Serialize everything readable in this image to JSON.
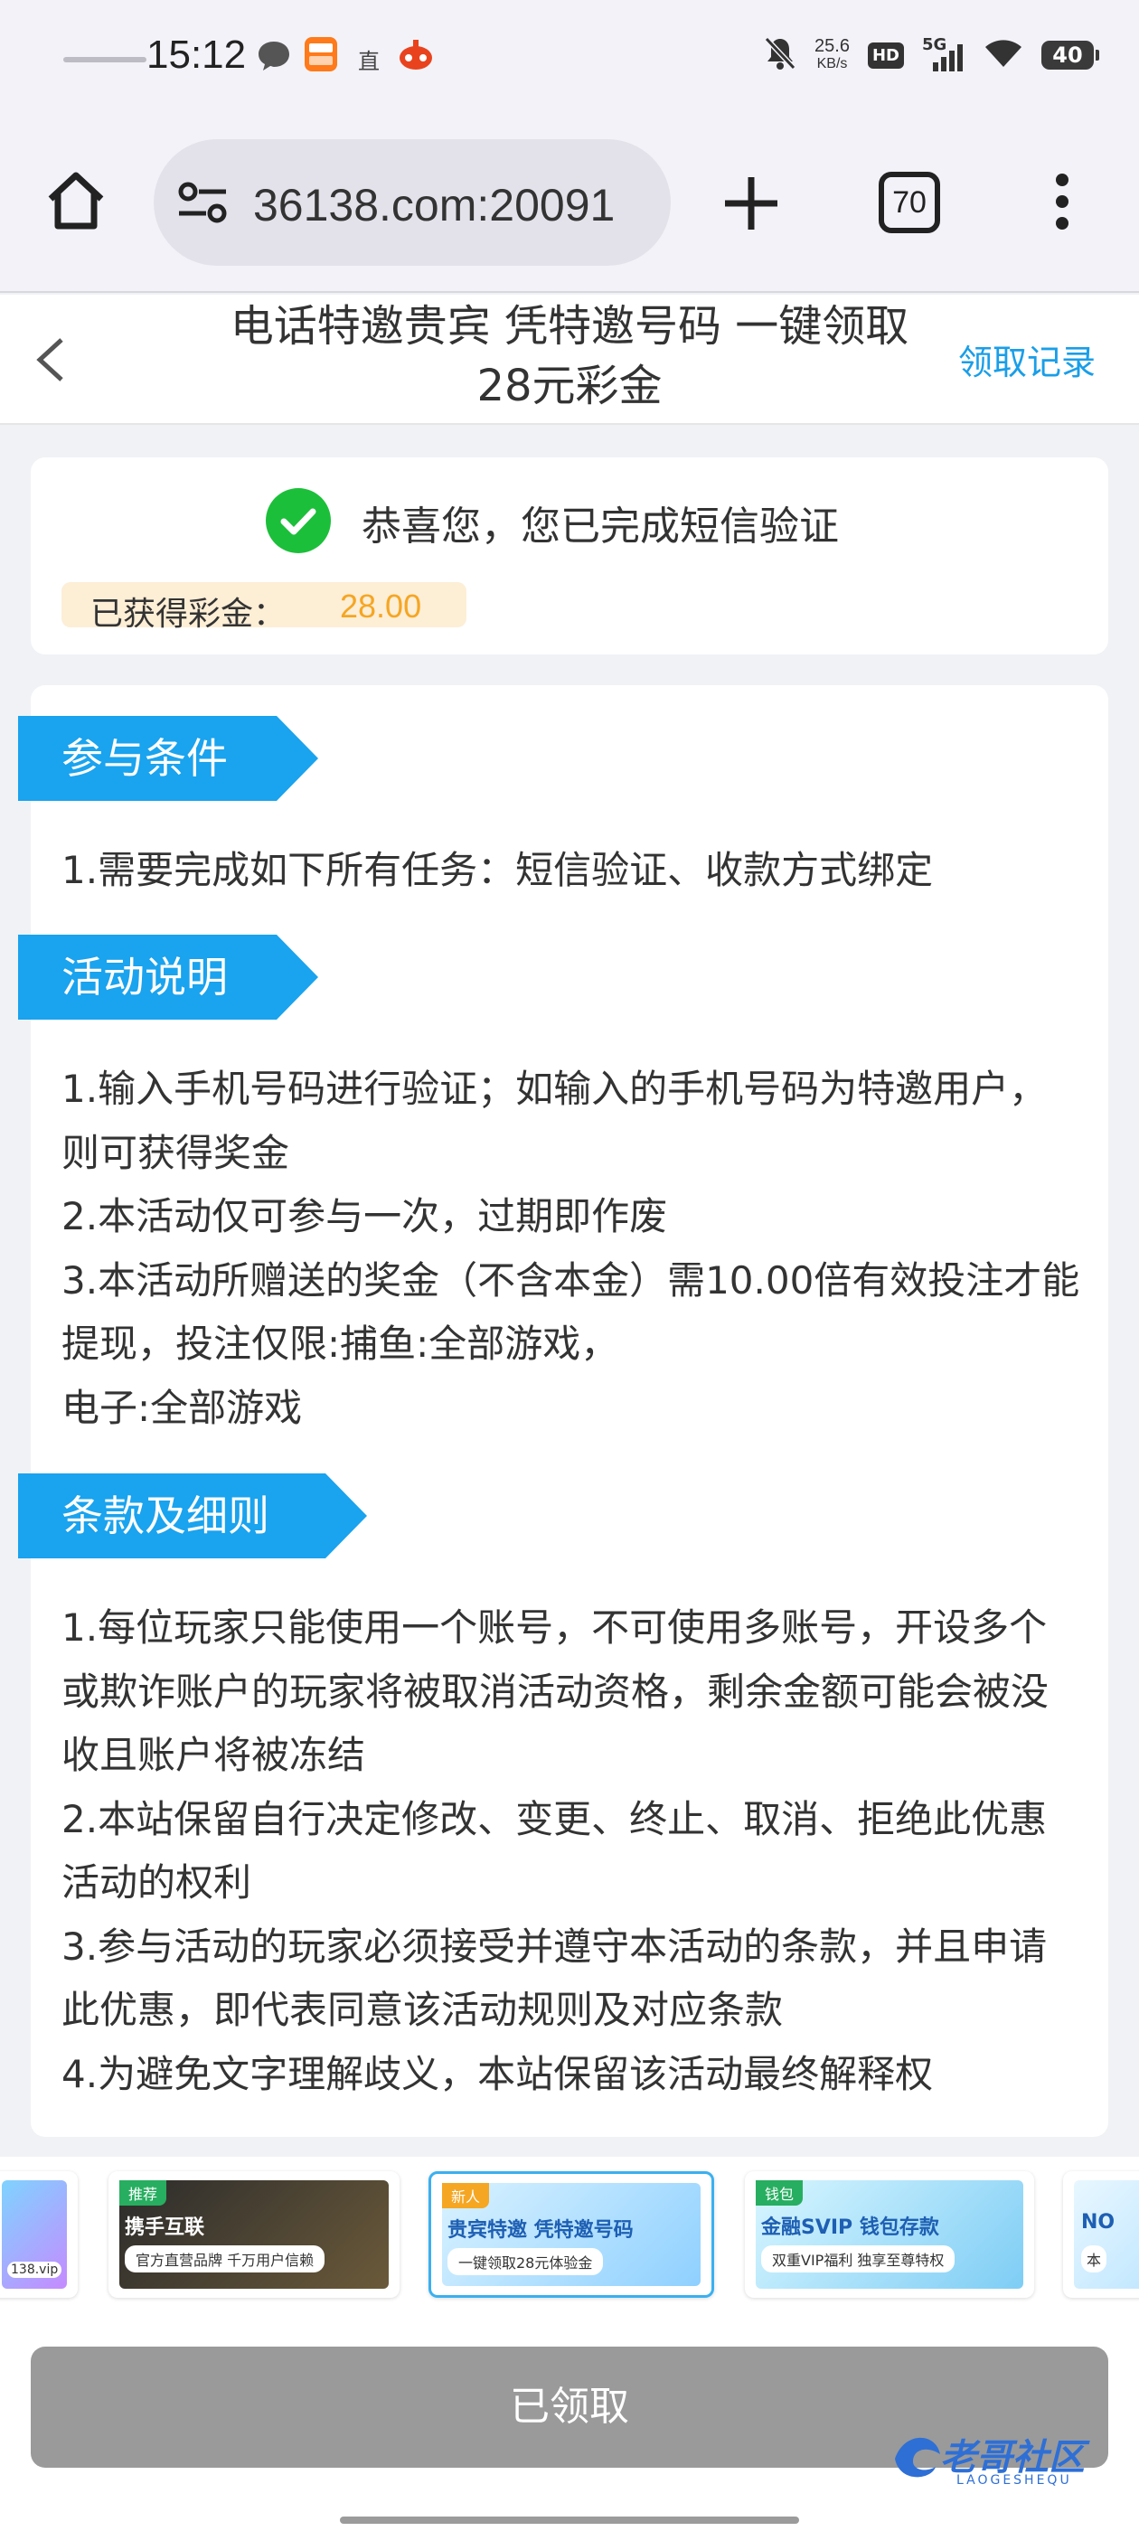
{
  "status_bar": {
    "time": "15:12",
    "net_speed_value": "25.6",
    "net_speed_unit": "KB/s",
    "hd_badge": "HD",
    "network": "5G",
    "battery": "40",
    "live_label": "直",
    "icons": [
      "chat-bubble-icon",
      "taobao-app-icon",
      "live-icon",
      "game-controller-icon",
      "mute-bell-icon",
      "signal-icon",
      "wifi-icon",
      "battery-icon"
    ]
  },
  "browser": {
    "url": "36138.com:20091",
    "tab_count": "70"
  },
  "header": {
    "title": "电话特邀贵宾 凭特邀号码 一键领取28元彩金",
    "records_link": "领取记录"
  },
  "success": {
    "message": "恭喜您，您已完成短信验证",
    "bonus_label": "已获得彩金：",
    "bonus_value": "28.00"
  },
  "sections": [
    {
      "title": "参与条件",
      "lines": [
        "1.需要完成如下所有任务：短信验证、收款方式绑定"
      ]
    },
    {
      "title": "活动说明",
      "lines": [
        "1.输入手机号码进行验证；如输入的手机号码为特邀用户，则可获得奖金",
        "2.本活动仅可参与一次，过期即作废",
        "3.本活动所赠送的奖金（不含本金）需10.00倍有效投注才能提现，投注仅限:捕鱼:全部游戏，",
        "电子:全部游戏"
      ]
    },
    {
      "title": "条款及细则",
      "lines": [
        "1.每位玩家只能使用一个账号，不可使用多账号，开设多个或欺诈账户的玩家将被取消活动资格，剩余金额可能会被没收且账户将被冻结",
        "2.本站保留自行决定修改、变更、终止、取消、拒绝此优惠活动的权利",
        "3.参与活动的玩家必须接受并遵守本活动的条款，并且申请此优惠，即代表同意该活动规则及对应条款",
        "4.为避免文字理解歧义，本站保留该活动最终解释权"
      ]
    }
  ],
  "banners": [
    {
      "tag": "",
      "title": "",
      "sub": "138.vip"
    },
    {
      "tag": "推荐",
      "title": "携手互联",
      "sub": "官方直营品牌 千万用户信赖"
    },
    {
      "tag": "新人",
      "title": "贵宾特邀 凭特邀号码",
      "sub": "一键领取28元体验金"
    },
    {
      "tag": "钱包",
      "title": "金融SVIP 钱包存款",
      "sub": "双重VIP福利 独享至尊特权"
    },
    {
      "tag": "",
      "title": "NO",
      "sub": "本"
    }
  ],
  "bottom": {
    "claim_button": "已领取",
    "watermark": "老哥社区",
    "watermark_sub": "LAOGESHEQU"
  },
  "colors": {
    "accent": "#1aa3ee",
    "link": "#1a9ee8",
    "success": "#1cbf3a",
    "bonus": "#f5a623",
    "disabled_button": "#9a9a9a"
  }
}
